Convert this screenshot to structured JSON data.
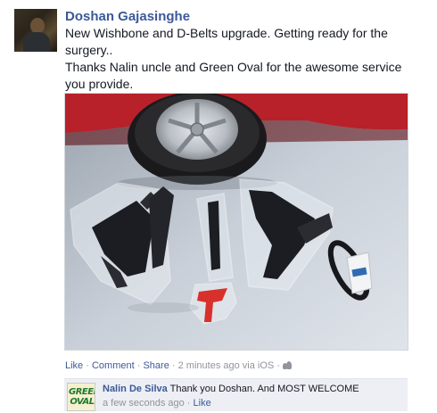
{
  "post": {
    "author": "Doshan Gajasinghe",
    "message_lines": [
      "New Wishbone and D-Belts upgrade. Getting ready for the surgery..",
      "Thanks Nalin uncle and Green Oval for the awesome service you provide."
    ],
    "actions": {
      "like": "Like",
      "comment": "Comment",
      "share": "Share",
      "separator": "·",
      "timestamp": "2 minutes ago via iOS",
      "audience_icon": "friends-icon"
    }
  },
  "comment": {
    "author": "Nalin De Silva",
    "text": "Thank you Doshan. And MOST WELCOME",
    "timestamp": "a few seconds ago",
    "like": "Like",
    "avatar_logo_top": "GREEN",
    "avatar_logo_bottom": "OVAL"
  },
  "colors": {
    "link": "#3b5998",
    "text": "#141823",
    "meta": "#90949c",
    "comment_bg": "#edeff4"
  }
}
